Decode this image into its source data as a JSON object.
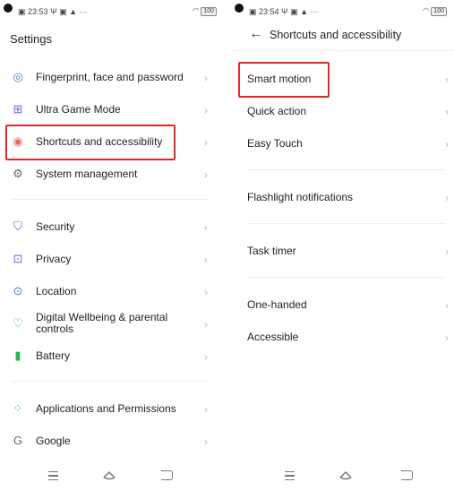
{
  "left": {
    "status": {
      "time": "23:53",
      "extra": "Ψ ▣ ▲ ···",
      "battery": "100"
    },
    "title": "Settings",
    "items": [
      {
        "label": "Fingerprint, face and password",
        "icon": "fingerprint-icon"
      },
      {
        "label": "Ultra Game Mode",
        "icon": "gamepad-icon"
      },
      {
        "label": "Shortcuts and accessibility",
        "icon": "accessibility-icon"
      },
      {
        "label": "System management",
        "icon": "gear-icon"
      },
      {
        "label": "Security",
        "icon": "shield-icon"
      },
      {
        "label": "Privacy",
        "icon": "lock-icon"
      },
      {
        "label": "Location",
        "icon": "location-icon"
      },
      {
        "label": "Digital Wellbeing & parental controls",
        "icon": "wellbeing-icon"
      },
      {
        "label": "Battery",
        "icon": "battery-icon"
      },
      {
        "label": "Applications and Permissions",
        "icon": "apps-icon"
      },
      {
        "label": "Google",
        "icon": "google-icon"
      }
    ]
  },
  "right": {
    "status": {
      "time": "23:54",
      "extra": "Ψ ▣ ▲ ···",
      "battery": "100"
    },
    "title": "Shortcuts and accessibility",
    "items": [
      {
        "label": "Smart motion"
      },
      {
        "label": "Quick action"
      },
      {
        "label": "Easy Touch"
      },
      {
        "label": "Flashlight notifications"
      },
      {
        "label": "Task timer"
      },
      {
        "label": "One-handed"
      },
      {
        "label": "Accessible"
      }
    ]
  },
  "colors": {
    "highlight": "#e02a2a",
    "accent": "#3a7bd5"
  }
}
